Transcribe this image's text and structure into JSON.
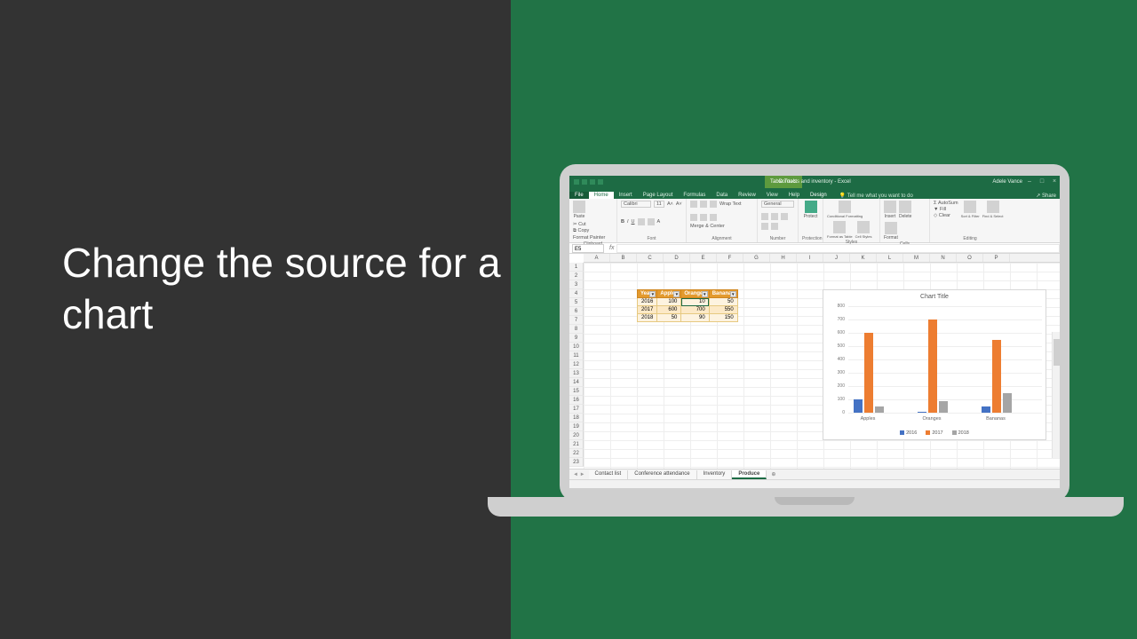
{
  "slide": {
    "title": "Change the source for a chart"
  },
  "titlebar": {
    "context_tool": "Table Tools",
    "doc_title": "Contacts and inventory - Excel",
    "user": "Adele Vance"
  },
  "tabs": {
    "file": "File",
    "home": "Home",
    "insert": "Insert",
    "page_layout": "Page Layout",
    "formulas": "Formulas",
    "data": "Data",
    "review": "Review",
    "view": "View",
    "help": "Help",
    "design": "Design",
    "tell_me": "Tell me what you want to do",
    "share": "Share"
  },
  "ribbon": {
    "clipboard": {
      "cut": "Cut",
      "copy": "Copy",
      "format_painter": "Format Painter",
      "label": "Clipboard"
    },
    "font": {
      "name": "Calibri",
      "size": "11",
      "label": "Font"
    },
    "alignment": {
      "wrap": "Wrap Text",
      "merge": "Merge & Center",
      "label": "Alignment"
    },
    "number_group": {
      "format": "General",
      "label": "Number"
    },
    "protection": {
      "protect": "Protect",
      "label": "Protection"
    },
    "styles": {
      "cf": "Conditional Formatting",
      "fat": "Format as Table",
      "cs": "Cell Styles",
      "label": "Styles"
    },
    "cells": {
      "insert": "Insert",
      "delete": "Delete",
      "format": "Format",
      "label": "Cells"
    },
    "editing": {
      "autosum": "AutoSum",
      "fill": "Fill",
      "clear": "Clear",
      "sort": "Sort & Filter",
      "find": "Find & Select",
      "label": "Editing"
    }
  },
  "namebox": "E5",
  "columns": [
    "A",
    "B",
    "C",
    "D",
    "E",
    "F",
    "G",
    "H",
    "I",
    "J",
    "K",
    "L",
    "M",
    "N",
    "O",
    "P"
  ],
  "row_count": 23,
  "table": {
    "headers": [
      "Year",
      "Apples",
      "Oranges",
      "Bananas"
    ],
    "rows": [
      [
        "2016",
        "100",
        "10",
        "50"
      ],
      [
        "2017",
        "600",
        "700",
        "550"
      ],
      [
        "2018",
        "50",
        "90",
        "150"
      ]
    ],
    "selected_value": "10"
  },
  "chart_data": {
    "type": "bar",
    "title": "Chart Title",
    "categories": [
      "Apples",
      "Oranges",
      "Bananas"
    ],
    "series": [
      {
        "name": "2016",
        "color": "#4472c4",
        "values": [
          100,
          10,
          50
        ]
      },
      {
        "name": "2017",
        "color": "#ed7d31",
        "values": [
          600,
          700,
          550
        ]
      },
      {
        "name": "2018",
        "color": "#a5a5a5",
        "values": [
          50,
          90,
          150
        ]
      }
    ],
    "yticks": [
      0,
      100,
      200,
      300,
      400,
      500,
      600,
      700,
      800
    ],
    "ylim": [
      0,
      800
    ]
  },
  "sheets": {
    "tabs": [
      "Contact list",
      "Conference attendance",
      "Inventory",
      "Produce"
    ],
    "active": "Produce"
  }
}
